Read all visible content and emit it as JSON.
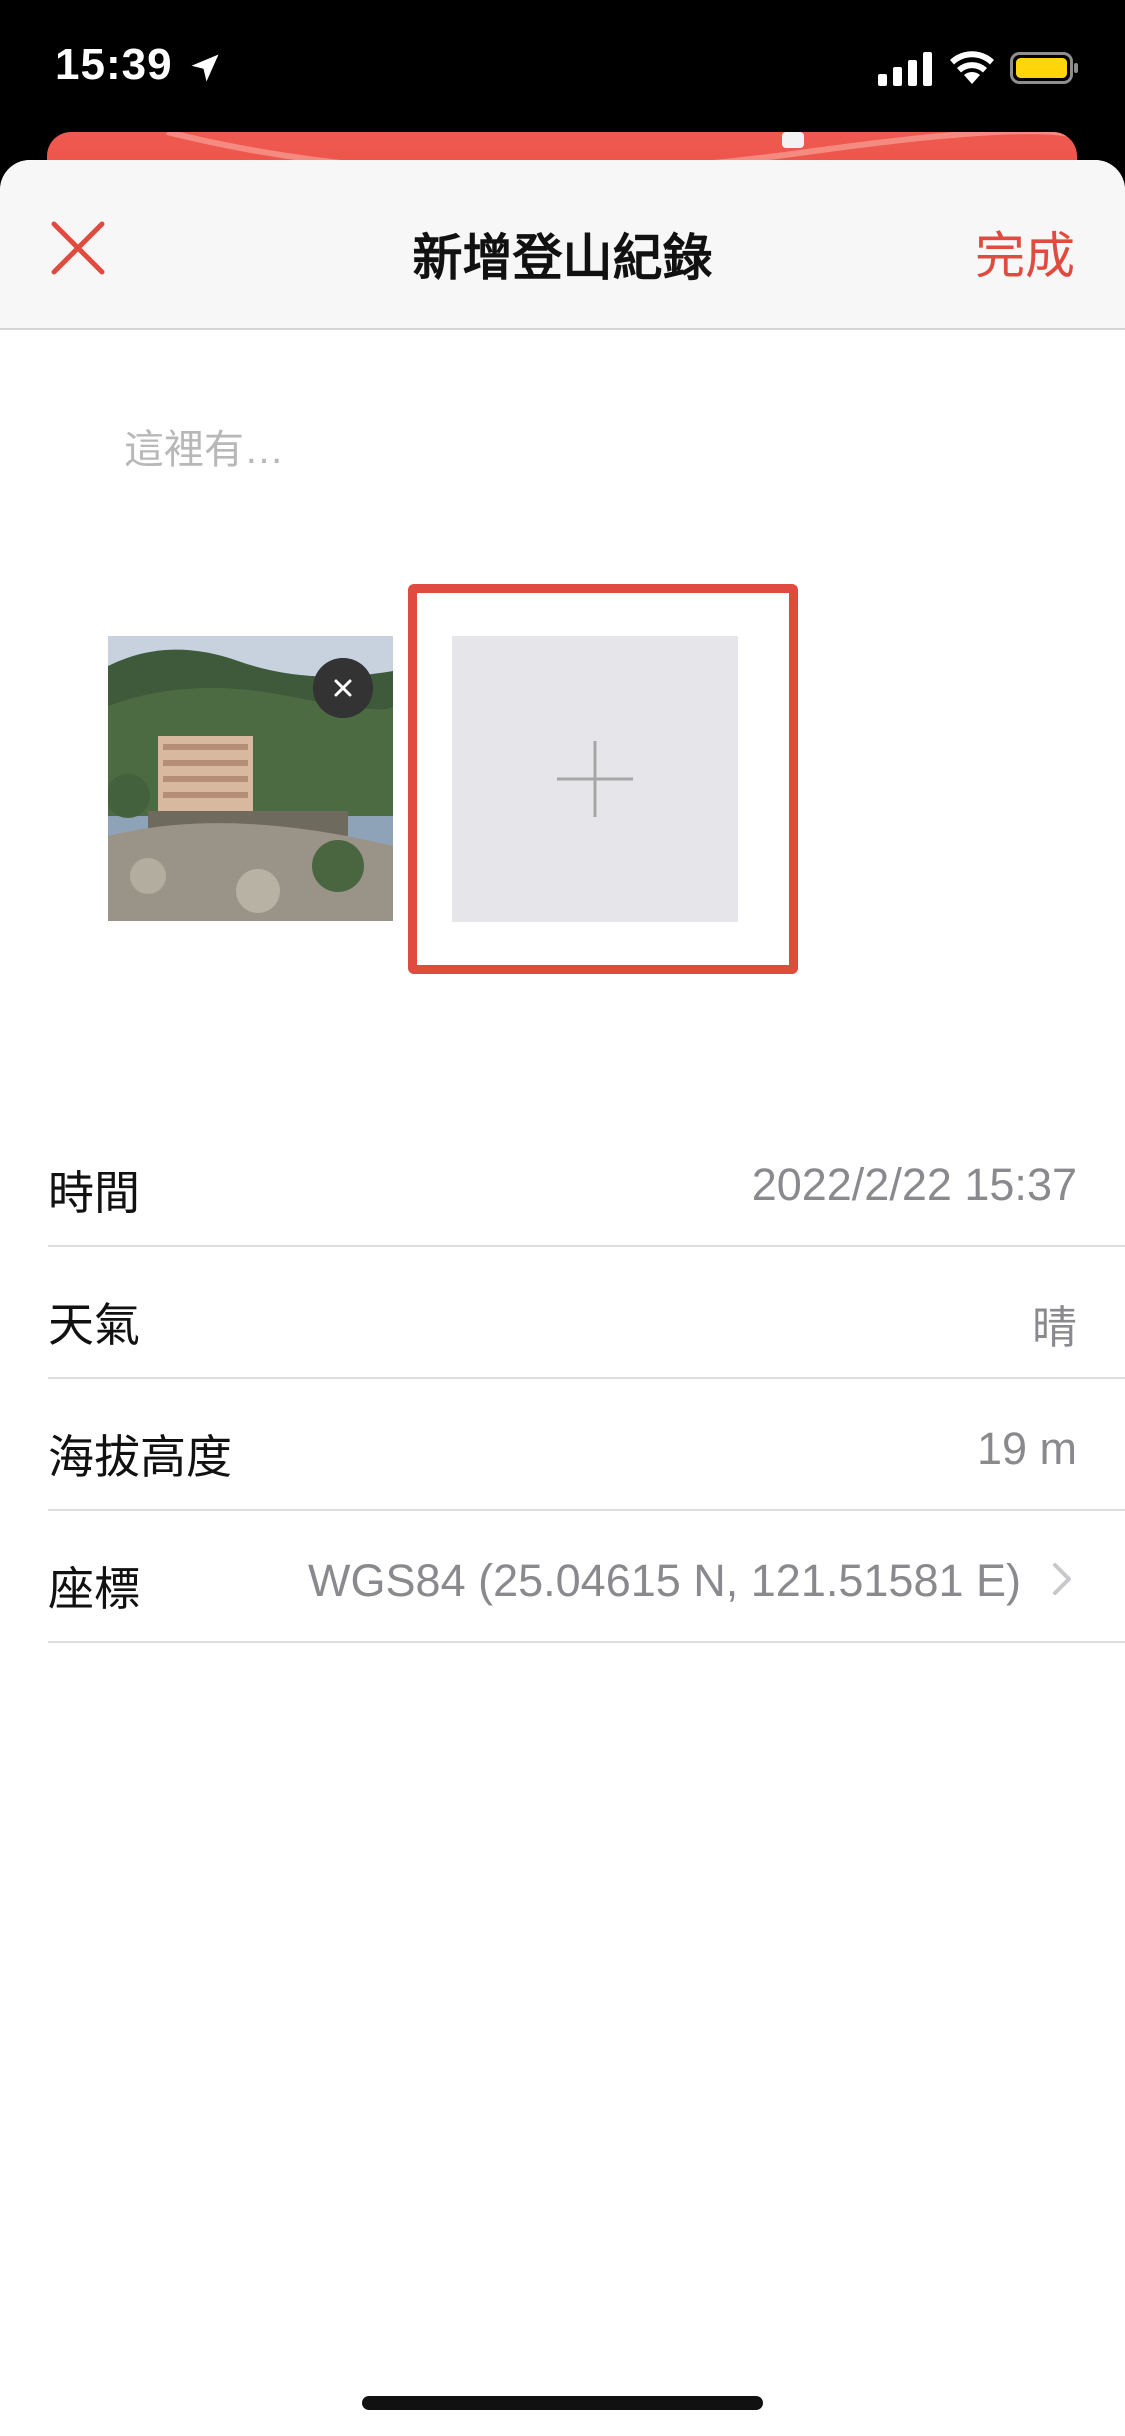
{
  "status_bar": {
    "time": "15:39",
    "icons": [
      "location-arrow-icon",
      "cellular-signal-icon",
      "wifi-icon",
      "battery-icon"
    ],
    "battery_color": "#ffd60a"
  },
  "header": {
    "title": "新增登山紀錄",
    "close_icon": "close-icon",
    "done_label": "完成"
  },
  "note": {
    "placeholder": "這裡有…",
    "value": ""
  },
  "photos": {
    "items": [
      {
        "alt": "mountain hotel photo",
        "remove_icon": "close-icon"
      }
    ],
    "add_icon": "plus-icon"
  },
  "info": {
    "rows": [
      {
        "label": "時間",
        "value": "2022/2/22 15:37"
      },
      {
        "label": "天氣",
        "value": "晴"
      },
      {
        "label": "海拔高度",
        "value": "19 m"
      },
      {
        "label": "座標",
        "value": "WGS84 (25.04615 N, 121.51581 E)",
        "icon": "chevron-right-icon"
      }
    ]
  },
  "colors": {
    "accent": "#e04b3f",
    "nav_background": "#f7f7f7",
    "secondary_text": "#8a8a8e"
  }
}
